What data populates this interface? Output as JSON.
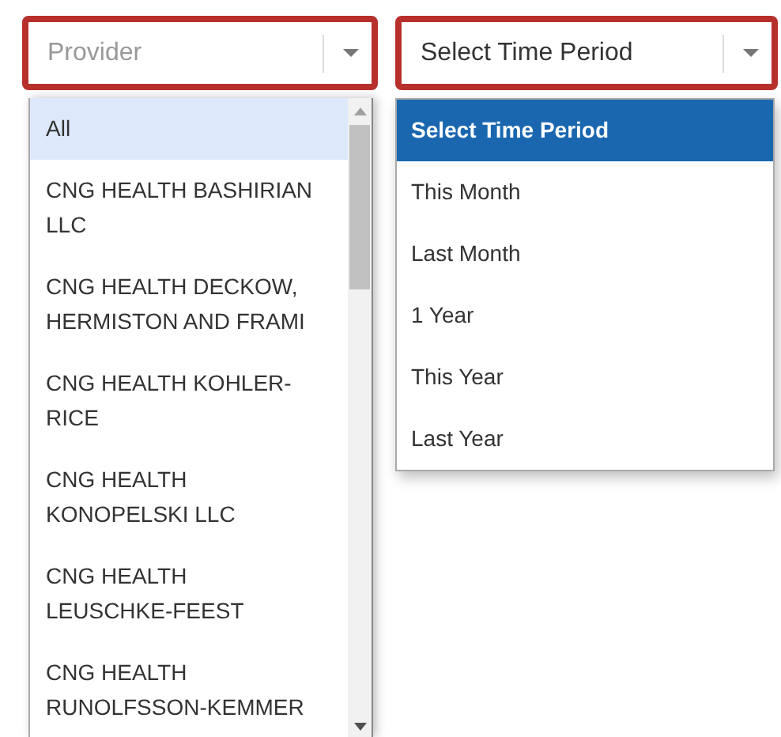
{
  "provider_select": {
    "placeholder": "Provider",
    "options": [
      {
        "label": "All",
        "selected": true
      },
      {
        "label": "CNG HEALTH BASHIRIAN LLC",
        "selected": false
      },
      {
        "label": "CNG HEALTH DECKOW, HERMISTON AND FRAMI",
        "selected": false
      },
      {
        "label": "CNG HEALTH KOHLER-RICE",
        "selected": false
      },
      {
        "label": "CNG HEALTH KONOPELSKI LLC",
        "selected": false
      },
      {
        "label": "CNG HEALTH LEUSCHKE-FEEST",
        "selected": false
      },
      {
        "label": "CNG HEALTH RUNOLFSSON-KEMMER",
        "selected": false
      }
    ]
  },
  "period_select": {
    "value": "Select Time Period",
    "options": [
      {
        "label": "Select Time Period",
        "selected": true
      },
      {
        "label": "This Month",
        "selected": false
      },
      {
        "label": "Last Month",
        "selected": false
      },
      {
        "label": "1 Year",
        "selected": false
      },
      {
        "label": "This Year",
        "selected": false
      },
      {
        "label": "Last Year",
        "selected": false
      }
    ]
  }
}
